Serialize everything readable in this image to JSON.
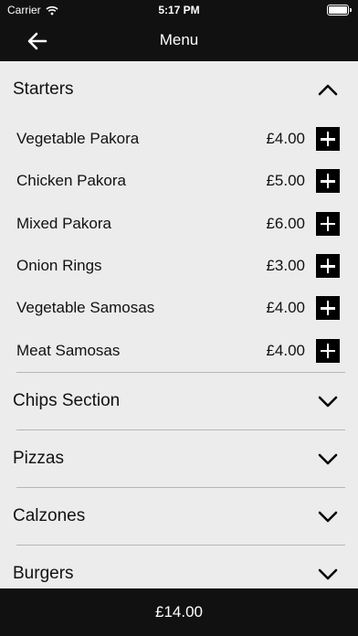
{
  "status_bar": {
    "carrier": "Carrier",
    "time": "5:17 PM"
  },
  "nav": {
    "title": "Menu"
  },
  "sections": [
    {
      "name": "Starters",
      "expanded": true,
      "items": [
        {
          "name": "Vegetable Pakora",
          "price": "£4.00"
        },
        {
          "name": "Chicken Pakora",
          "price": "£5.00"
        },
        {
          "name": "Mixed Pakora",
          "price": "£6.00"
        },
        {
          "name": "Onion Rings",
          "price": "£3.00"
        },
        {
          "name": "Vegetable Samosas",
          "price": "£4.00"
        },
        {
          "name": "Meat Samosas",
          "price": "£4.00"
        }
      ]
    },
    {
      "name": "Chips Section",
      "expanded": false
    },
    {
      "name": "Pizzas",
      "expanded": false
    },
    {
      "name": "Calzones",
      "expanded": false
    },
    {
      "name": "Burgers",
      "expanded": false
    }
  ],
  "footer": {
    "total": "£14.00"
  }
}
